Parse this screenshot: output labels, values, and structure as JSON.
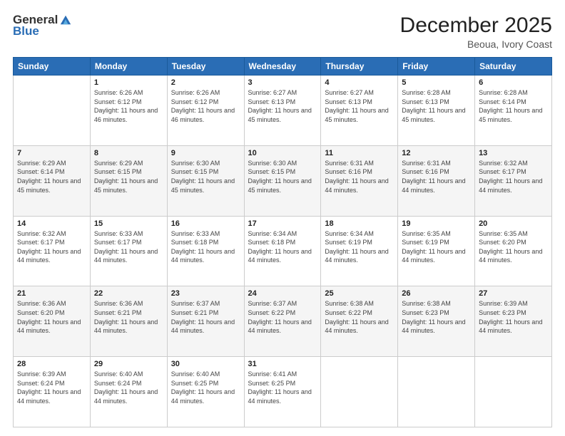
{
  "logo": {
    "general": "General",
    "blue": "Blue"
  },
  "header": {
    "title": "December 2025",
    "subtitle": "Beoua, Ivory Coast"
  },
  "calendar": {
    "days_of_week": [
      "Sunday",
      "Monday",
      "Tuesday",
      "Wednesday",
      "Thursday",
      "Friday",
      "Saturday"
    ],
    "weeks": [
      [
        {
          "day": "",
          "sunrise": "",
          "sunset": "",
          "daylight": ""
        },
        {
          "day": "1",
          "sunrise": "Sunrise: 6:26 AM",
          "sunset": "Sunset: 6:12 PM",
          "daylight": "Daylight: 11 hours and 46 minutes."
        },
        {
          "day": "2",
          "sunrise": "Sunrise: 6:26 AM",
          "sunset": "Sunset: 6:12 PM",
          "daylight": "Daylight: 11 hours and 46 minutes."
        },
        {
          "day": "3",
          "sunrise": "Sunrise: 6:27 AM",
          "sunset": "Sunset: 6:13 PM",
          "daylight": "Daylight: 11 hours and 45 minutes."
        },
        {
          "day": "4",
          "sunrise": "Sunrise: 6:27 AM",
          "sunset": "Sunset: 6:13 PM",
          "daylight": "Daylight: 11 hours and 45 minutes."
        },
        {
          "day": "5",
          "sunrise": "Sunrise: 6:28 AM",
          "sunset": "Sunset: 6:13 PM",
          "daylight": "Daylight: 11 hours and 45 minutes."
        },
        {
          "day": "6",
          "sunrise": "Sunrise: 6:28 AM",
          "sunset": "Sunset: 6:14 PM",
          "daylight": "Daylight: 11 hours and 45 minutes."
        }
      ],
      [
        {
          "day": "7",
          "sunrise": "Sunrise: 6:29 AM",
          "sunset": "Sunset: 6:14 PM",
          "daylight": "Daylight: 11 hours and 45 minutes."
        },
        {
          "day": "8",
          "sunrise": "Sunrise: 6:29 AM",
          "sunset": "Sunset: 6:15 PM",
          "daylight": "Daylight: 11 hours and 45 minutes."
        },
        {
          "day": "9",
          "sunrise": "Sunrise: 6:30 AM",
          "sunset": "Sunset: 6:15 PM",
          "daylight": "Daylight: 11 hours and 45 minutes."
        },
        {
          "day": "10",
          "sunrise": "Sunrise: 6:30 AM",
          "sunset": "Sunset: 6:15 PM",
          "daylight": "Daylight: 11 hours and 45 minutes."
        },
        {
          "day": "11",
          "sunrise": "Sunrise: 6:31 AM",
          "sunset": "Sunset: 6:16 PM",
          "daylight": "Daylight: 11 hours and 44 minutes."
        },
        {
          "day": "12",
          "sunrise": "Sunrise: 6:31 AM",
          "sunset": "Sunset: 6:16 PM",
          "daylight": "Daylight: 11 hours and 44 minutes."
        },
        {
          "day": "13",
          "sunrise": "Sunrise: 6:32 AM",
          "sunset": "Sunset: 6:17 PM",
          "daylight": "Daylight: 11 hours and 44 minutes."
        }
      ],
      [
        {
          "day": "14",
          "sunrise": "Sunrise: 6:32 AM",
          "sunset": "Sunset: 6:17 PM",
          "daylight": "Daylight: 11 hours and 44 minutes."
        },
        {
          "day": "15",
          "sunrise": "Sunrise: 6:33 AM",
          "sunset": "Sunset: 6:17 PM",
          "daylight": "Daylight: 11 hours and 44 minutes."
        },
        {
          "day": "16",
          "sunrise": "Sunrise: 6:33 AM",
          "sunset": "Sunset: 6:18 PM",
          "daylight": "Daylight: 11 hours and 44 minutes."
        },
        {
          "day": "17",
          "sunrise": "Sunrise: 6:34 AM",
          "sunset": "Sunset: 6:18 PM",
          "daylight": "Daylight: 11 hours and 44 minutes."
        },
        {
          "day": "18",
          "sunrise": "Sunrise: 6:34 AM",
          "sunset": "Sunset: 6:19 PM",
          "daylight": "Daylight: 11 hours and 44 minutes."
        },
        {
          "day": "19",
          "sunrise": "Sunrise: 6:35 AM",
          "sunset": "Sunset: 6:19 PM",
          "daylight": "Daylight: 11 hours and 44 minutes."
        },
        {
          "day": "20",
          "sunrise": "Sunrise: 6:35 AM",
          "sunset": "Sunset: 6:20 PM",
          "daylight": "Daylight: 11 hours and 44 minutes."
        }
      ],
      [
        {
          "day": "21",
          "sunrise": "Sunrise: 6:36 AM",
          "sunset": "Sunset: 6:20 PM",
          "daylight": "Daylight: 11 hours and 44 minutes."
        },
        {
          "day": "22",
          "sunrise": "Sunrise: 6:36 AM",
          "sunset": "Sunset: 6:21 PM",
          "daylight": "Daylight: 11 hours and 44 minutes."
        },
        {
          "day": "23",
          "sunrise": "Sunrise: 6:37 AM",
          "sunset": "Sunset: 6:21 PM",
          "daylight": "Daylight: 11 hours and 44 minutes."
        },
        {
          "day": "24",
          "sunrise": "Sunrise: 6:37 AM",
          "sunset": "Sunset: 6:22 PM",
          "daylight": "Daylight: 11 hours and 44 minutes."
        },
        {
          "day": "25",
          "sunrise": "Sunrise: 6:38 AM",
          "sunset": "Sunset: 6:22 PM",
          "daylight": "Daylight: 11 hours and 44 minutes."
        },
        {
          "day": "26",
          "sunrise": "Sunrise: 6:38 AM",
          "sunset": "Sunset: 6:23 PM",
          "daylight": "Daylight: 11 hours and 44 minutes."
        },
        {
          "day": "27",
          "sunrise": "Sunrise: 6:39 AM",
          "sunset": "Sunset: 6:23 PM",
          "daylight": "Daylight: 11 hours and 44 minutes."
        }
      ],
      [
        {
          "day": "28",
          "sunrise": "Sunrise: 6:39 AM",
          "sunset": "Sunset: 6:24 PM",
          "daylight": "Daylight: 11 hours and 44 minutes."
        },
        {
          "day": "29",
          "sunrise": "Sunrise: 6:40 AM",
          "sunset": "Sunset: 6:24 PM",
          "daylight": "Daylight: 11 hours and 44 minutes."
        },
        {
          "day": "30",
          "sunrise": "Sunrise: 6:40 AM",
          "sunset": "Sunset: 6:25 PM",
          "daylight": "Daylight: 11 hours and 44 minutes."
        },
        {
          "day": "31",
          "sunrise": "Sunrise: 6:41 AM",
          "sunset": "Sunset: 6:25 PM",
          "daylight": "Daylight: 11 hours and 44 minutes."
        },
        {
          "day": "",
          "sunrise": "",
          "sunset": "",
          "daylight": ""
        },
        {
          "day": "",
          "sunrise": "",
          "sunset": "",
          "daylight": ""
        },
        {
          "day": "",
          "sunrise": "",
          "sunset": "",
          "daylight": ""
        }
      ]
    ]
  }
}
